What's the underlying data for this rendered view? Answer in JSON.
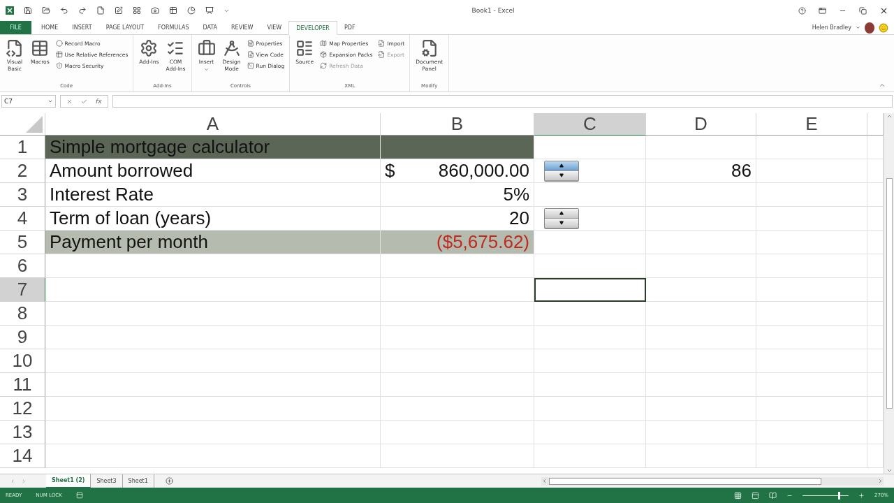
{
  "window": {
    "title": "Book1 - Excel"
  },
  "user": {
    "name": "Helen Bradley"
  },
  "tabs": [
    {
      "label": "FILE",
      "kind": "file",
      "selected": false
    },
    {
      "label": "HOME",
      "kind": "tab",
      "selected": false
    },
    {
      "label": "INSERT",
      "kind": "tab",
      "selected": false
    },
    {
      "label": "PAGE LAYOUT",
      "kind": "tab",
      "selected": false
    },
    {
      "label": "FORMULAS",
      "kind": "tab",
      "selected": false
    },
    {
      "label": "DATA",
      "kind": "tab",
      "selected": false
    },
    {
      "label": "REVIEW",
      "kind": "tab",
      "selected": false
    },
    {
      "label": "VIEW",
      "kind": "tab",
      "selected": false
    },
    {
      "label": "DEVELOPER",
      "kind": "tab",
      "selected": true
    },
    {
      "label": "PDF",
      "kind": "tab",
      "selected": false
    }
  ],
  "ribbon": {
    "groups": [
      {
        "name": "Code",
        "items": [
          {
            "label": "Visual\nBasic",
            "kind": "large",
            "disabled": false
          },
          {
            "label": "Macros",
            "kind": "large",
            "disabled": false
          },
          {
            "kind": "stack",
            "items": [
              {
                "label": "Record Macro",
                "disabled": false
              },
              {
                "label": "Use Relative References",
                "disabled": false
              },
              {
                "label": "Macro Security",
                "disabled": false
              }
            ]
          }
        ]
      },
      {
        "name": "Add-Ins",
        "items": [
          {
            "label": "Add-Ins",
            "kind": "large",
            "disabled": false
          },
          {
            "label": "COM\nAdd-Ins",
            "kind": "large",
            "disabled": false
          }
        ]
      },
      {
        "name": "Controls",
        "items": [
          {
            "label": "Insert",
            "kind": "large",
            "dropdown": true,
            "disabled": false
          },
          {
            "label": "Design\nMode",
            "kind": "large",
            "disabled": false
          },
          {
            "kind": "stack",
            "items": [
              {
                "label": "Properties",
                "disabled": false
              },
              {
                "label": "View Code",
                "disabled": false
              },
              {
                "label": "Run Dialog",
                "disabled": false
              }
            ]
          }
        ]
      },
      {
        "name": "XML",
        "items": [
          {
            "label": "Source",
            "kind": "large",
            "disabled": false
          },
          {
            "kind": "stack",
            "items": [
              {
                "label": "Map Properties",
                "disabled": false
              },
              {
                "label": "Expansion Packs",
                "disabled": false
              },
              {
                "label": "Refresh Data",
                "disabled": true
              }
            ]
          },
          {
            "kind": "stack",
            "items": [
              {
                "label": "Import",
                "disabled": false
              },
              {
                "label": "Export",
                "disabled": true
              }
            ]
          }
        ]
      },
      {
        "name": "Modify",
        "items": [
          {
            "label": "Document\nPanel",
            "kind": "large",
            "disabled": false
          }
        ]
      }
    ]
  },
  "formula_bar": {
    "name_box": "C7",
    "function_label": "fx"
  },
  "columns": [
    {
      "label": "A",
      "selected": false
    },
    {
      "label": "B",
      "selected": false
    },
    {
      "label": "C",
      "selected": true
    },
    {
      "label": "D",
      "selected": false
    },
    {
      "label": "E",
      "selected": false
    }
  ],
  "rows": [
    {
      "label": "1",
      "selected": false,
      "kind": "title",
      "cells": {
        "a": {
          "kind": "text",
          "text": "Simple mortgage calculator",
          "negative": false
        }
      }
    },
    {
      "label": "2",
      "selected": false,
      "kind": "plain",
      "cells": {
        "a": {
          "kind": "text",
          "text": "Amount borrowed",
          "negative": false
        },
        "b": {
          "kind": "currency",
          "symbol": "$",
          "text": "860,000.00",
          "negative": false
        },
        "c": {
          "kind": "spinner",
          "hovered": true
        },
        "d": {
          "kind": "number",
          "text": "86",
          "negative": false
        }
      }
    },
    {
      "label": "3",
      "selected": false,
      "kind": "plain",
      "cells": {
        "a": {
          "kind": "text",
          "text": "Interest Rate",
          "negative": false
        },
        "b": {
          "kind": "number",
          "text": "5%",
          "negative": false
        }
      }
    },
    {
      "label": "4",
      "selected": false,
      "kind": "plain",
      "cells": {
        "a": {
          "kind": "text",
          "text": "Term of loan (years)",
          "negative": false
        },
        "b": {
          "kind": "number",
          "text": "20",
          "negative": false
        },
        "c": {
          "kind": "spinner",
          "hovered": false
        }
      }
    },
    {
      "label": "5",
      "selected": false,
      "kind": "total",
      "cells": {
        "a": {
          "kind": "text",
          "text": "Payment per month",
          "negative": false
        },
        "b": {
          "kind": "number",
          "text": "($5,675.62)",
          "negative": true
        }
      }
    },
    {
      "label": "6",
      "selected": false,
      "kind": "plain",
      "cells": {}
    },
    {
      "label": "7",
      "selected": true,
      "kind": "plain",
      "cells": {}
    },
    {
      "label": "8",
      "selected": false,
      "kind": "plain",
      "cells": {}
    },
    {
      "label": "9",
      "selected": false,
      "kind": "plain",
      "cells": {}
    },
    {
      "label": "10",
      "selected": false,
      "kind": "plain",
      "cells": {}
    },
    {
      "label": "11",
      "selected": false,
      "kind": "plain",
      "cells": {}
    },
    {
      "label": "12",
      "selected": false,
      "kind": "plain",
      "cells": {}
    },
    {
      "label": "13",
      "selected": false,
      "kind": "plain",
      "cells": {}
    },
    {
      "label": "14",
      "selected": false,
      "kind": "plain",
      "cells": {}
    }
  ],
  "sheet_tabs": [
    {
      "label": "Sheet1 (2)",
      "selected": true
    },
    {
      "label": "Sheet3",
      "selected": false
    },
    {
      "label": "Sheet1",
      "selected": false
    }
  ],
  "status_bar": {
    "mode": "READY",
    "indicator": "NUM LOCK",
    "zoom": "270%",
    "zoom_slider": {
      "level": 0.78
    }
  }
}
